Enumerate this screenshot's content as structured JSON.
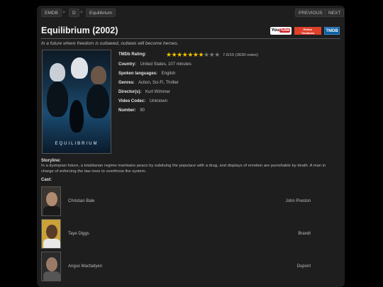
{
  "breadcrumb": {
    "root": "EMDB",
    "letter": "D",
    "current": "Equilibrium",
    "separator": ">"
  },
  "nav": {
    "previous": "PREVIOUS",
    "next": "NEXT"
  },
  "movie": {
    "title": "Equilibrium (2002)",
    "tagline": "In a future where freedom is outlawed, outlaws will become heroes.",
    "poster_title": "EQUILIBRIUM"
  },
  "links": {
    "youtube": "YouTube",
    "rotten": "Rotten Tomatoes",
    "tmdb": "TMDB"
  },
  "details": {
    "rating_label": "TMDb Rating:",
    "rating_text": "7.0/10 (3630 votes)",
    "stars_filled": 7,
    "stars_total": 10,
    "country_label": "Country:",
    "country": "United States, 107 minutes",
    "languages_label": "Spoken languages:",
    "languages": "English",
    "genres_label": "Genres:",
    "genres": "Action, Sci-Fi, Thriller",
    "directors_label": "Director(s):",
    "directors": "Kurt Wimmer",
    "codec_label": "Video Codec:",
    "codec": "Unknown",
    "number_label": "Number:",
    "number": "90"
  },
  "storyline": {
    "heading": "Storyline:",
    "text": "In a dystopian future, a totalitarian regime maintains peace by subduing the populace with a drug, and displays of emotion are punishable by death. A man in charge of enforcing the law rises to overthrow the system."
  },
  "cast": {
    "heading": "Cast:",
    "members": [
      {
        "actor": "Christian Bale",
        "character": "John Preston"
      },
      {
        "actor": "Taye Diggs",
        "character": "Brandt"
      },
      {
        "actor": "Angus Macfadyen",
        "character": "Dupont"
      }
    ]
  },
  "colors": {
    "background": "#000000",
    "panel": "#1e1e1e",
    "star": "#f2c200",
    "youtube_red": "#cc181e",
    "rotten_red": "#e0402a",
    "tmdb_blue": "#0d5fa0"
  }
}
